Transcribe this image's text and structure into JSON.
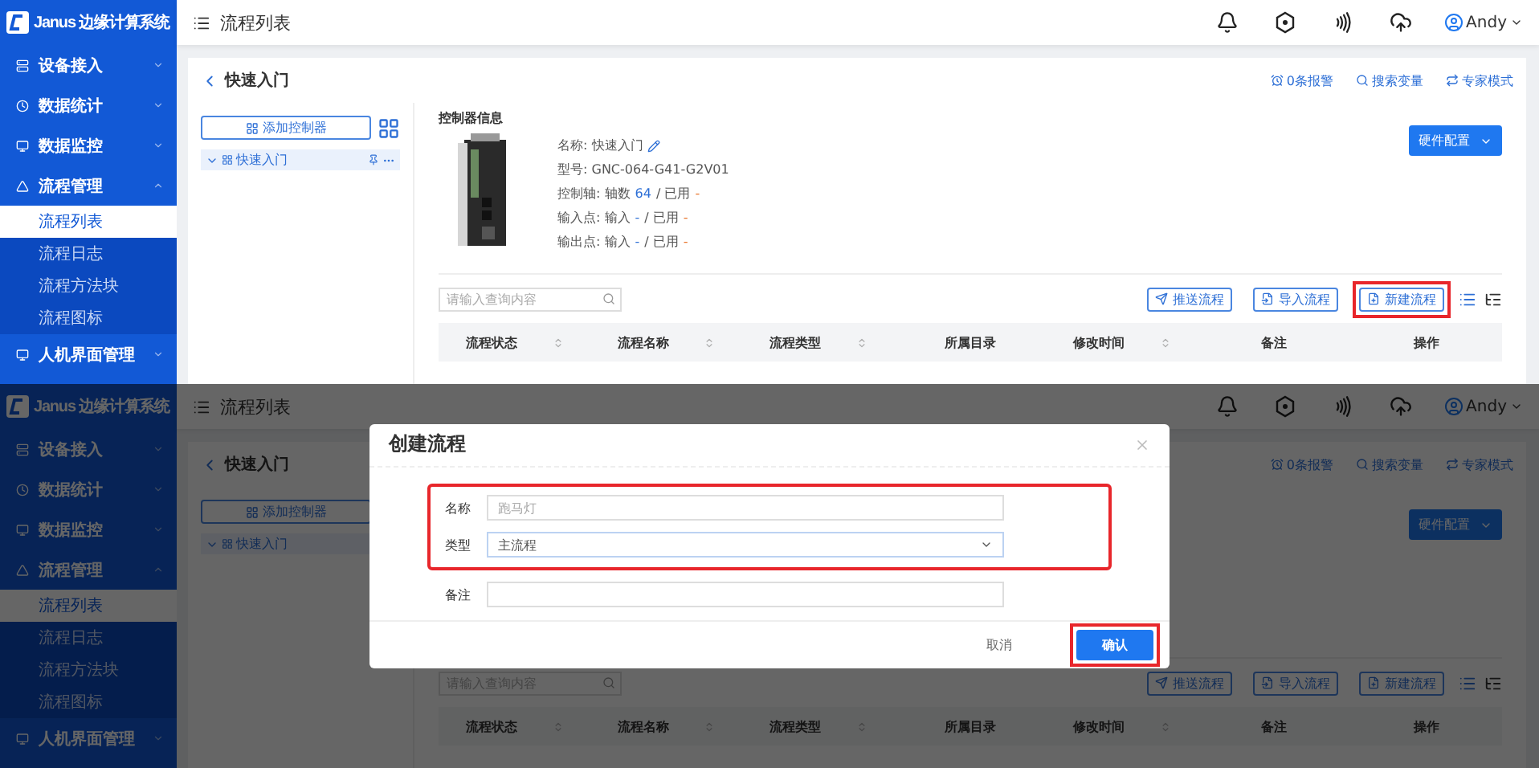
{
  "screens": [
    {
      "sidebar": {
        "logo": "Janus 边缘计算系统",
        "items": [
          {
            "label": "设备接入",
            "expanded": false
          },
          {
            "label": "数据统计",
            "expanded": false
          },
          {
            "label": "数据监控",
            "expanded": false
          },
          {
            "label": "流程管理",
            "expanded": true,
            "children": [
              {
                "label": "流程列表",
                "selected": true
              },
              {
                "label": "流程日志",
                "selected": false
              },
              {
                "label": "流程方法块",
                "selected": false
              },
              {
                "label": "流程图标",
                "selected": false
              }
            ]
          },
          {
            "label": "人机界面管理",
            "expanded": false
          }
        ]
      },
      "header": {
        "title": "流程列表",
        "user": "Andy"
      },
      "page": {
        "title": "快速入门",
        "links": [
          "0条报警",
          "搜索变量",
          "专家模式"
        ],
        "add_button": "添加控制器",
        "tree": [
          {
            "label": "快速入门",
            "expanded": true
          }
        ],
        "controller": {
          "section_title": "控制器信息",
          "fields": [
            {
              "kind": "name",
              "label": "名称:",
              "value": "快速入门"
            },
            {
              "kind": "text",
              "label": "型号:",
              "value": "GNC-064-G41-G2V01"
            },
            {
              "kind": "usage",
              "label": "控制轴:",
              "total_label": "轴数",
              "total": "64",
              "separator": "/",
              "used_label": "已用",
              "used": "-"
            },
            {
              "kind": "usage",
              "label": "输入点:",
              "total_label": "输入",
              "total": "-",
              "separator": "/",
              "used_label": "已用",
              "used": "-"
            },
            {
              "kind": "usage",
              "label": "输出点:",
              "total_label": "输入",
              "total": "-",
              "separator": "/",
              "used_label": "已用",
              "used": "-"
            }
          ]
        },
        "hardware_button": "硬件配置",
        "search": {
          "placeholder": "请输入查询内容"
        },
        "actions": [
          {
            "label": "推送流程",
            "highlighted": false
          },
          {
            "label": "导入流程",
            "highlighted": false
          },
          {
            "label": "新建流程",
            "highlighted": true
          }
        ],
        "view_toggles": [
          {
            "selected": true
          },
          {
            "selected": false
          }
        ],
        "table": {
          "columns": [
            {
              "label": "流程状态",
              "sortable": true
            },
            {
              "label": "流程名称",
              "sortable": true
            },
            {
              "label": "流程类型",
              "sortable": true
            },
            {
              "label": "所属目录",
              "sortable": false
            },
            {
              "label": "修改时间",
              "sortable": true
            },
            {
              "label": "备注",
              "sortable": false
            },
            {
              "label": "操作",
              "sortable": false
            }
          ]
        }
      }
    },
    {
      "sidebar": {
        "logo": "Janus 边缘计算系统",
        "items": [
          {
            "label": "设备接入",
            "expanded": false
          },
          {
            "label": "数据统计",
            "expanded": false
          },
          {
            "label": "数据监控",
            "expanded": false
          },
          {
            "label": "流程管理",
            "expanded": true,
            "children": [
              {
                "label": "流程列表",
                "selected": true
              },
              {
                "label": "流程日志",
                "selected": false
              },
              {
                "label": "流程方法块",
                "selected": false
              },
              {
                "label": "流程图标",
                "selected": false
              }
            ]
          },
          {
            "label": "人机界面管理",
            "expanded": false
          }
        ]
      },
      "header": {
        "title": "流程列表",
        "user": "Andy"
      },
      "page": {
        "title": "快速入门",
        "links": [
          "0条报警",
          "搜索变量",
          "专家模式"
        ],
        "add_button": "添加控制器",
        "tree": [
          {
            "label": "快速入门",
            "expanded": true
          }
        ],
        "hardware_button": "硬件配置",
        "search": {
          "placeholder": "请输入查询内容"
        },
        "actions": [
          {
            "label": "推送流程",
            "highlighted": false
          },
          {
            "label": "导入流程",
            "highlighted": false
          },
          {
            "label": "新建流程",
            "highlighted": false
          }
        ],
        "view_toggles": [
          {
            "selected": true
          },
          {
            "selected": false
          }
        ],
        "table": {
          "columns": [
            {
              "label": "流程状态",
              "sortable": true
            },
            {
              "label": "流程名称",
              "sortable": true
            },
            {
              "label": "流程类型",
              "sortable": true
            },
            {
              "label": "所属目录",
              "sortable": false
            },
            {
              "label": "修改时间",
              "sortable": true
            },
            {
              "label": "备注",
              "sortable": false
            },
            {
              "label": "操作",
              "sortable": false
            }
          ]
        }
      },
      "dialog": {
        "title": "创建流程",
        "fields": [
          {
            "kind": "text",
            "label": "名称",
            "placeholder": "跑马灯",
            "highlighted": true
          },
          {
            "kind": "select",
            "label": "类型",
            "value": "主流程",
            "highlighted": true
          },
          {
            "kind": "text",
            "label": "备注",
            "highlighted": false
          }
        ],
        "buttons": [
          {
            "kind": "secondary",
            "label": "取消",
            "highlighted": false
          },
          {
            "kind": "primary",
            "label": "确认",
            "highlighted": true
          }
        ]
      }
    }
  ]
}
